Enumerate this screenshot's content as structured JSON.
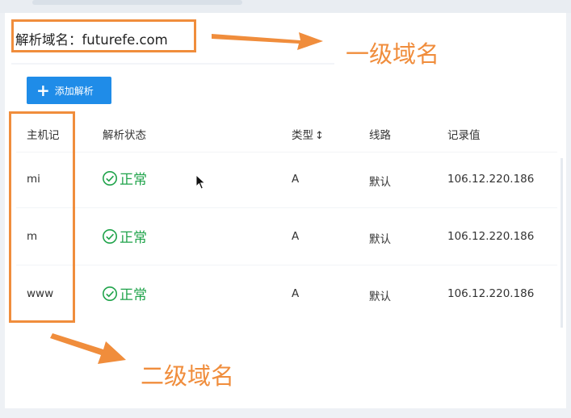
{
  "domain": {
    "label": "解析域名：",
    "value": "futurefe.com"
  },
  "toolbar": {
    "add_label": "添加解析",
    "add_icon": "plus-icon"
  },
  "table": {
    "headers": {
      "host": "主机记",
      "status": "解析状态",
      "type": "类型",
      "line": "线路",
      "value": "记录值"
    },
    "rows": [
      {
        "host": "mi",
        "status": "正常",
        "type": "A",
        "line": "默认",
        "value": "106.12.220.186"
      },
      {
        "host": "m",
        "status": "正常",
        "type": "A",
        "line": "默认",
        "value": "106.12.220.186"
      },
      {
        "host": "www",
        "status": "正常",
        "type": "A",
        "line": "默认",
        "value": "106.12.220.186"
      }
    ]
  },
  "annotations": {
    "first_level": "一级域名",
    "second_level": "二级域名"
  },
  "colors": {
    "accent": "#1f8ce8",
    "annotation": "#f08d3c",
    "status_ok": "#1fa34a"
  }
}
